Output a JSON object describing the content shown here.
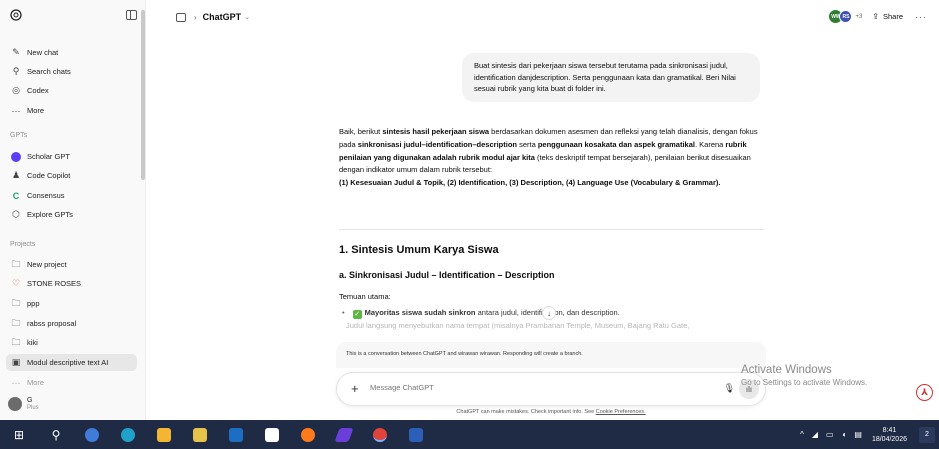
{
  "sidebar": {
    "items": [
      {
        "label": "New chat",
        "icon": "edit-icon"
      },
      {
        "label": "Search chats",
        "icon": "search-icon"
      },
      {
        "label": "Codex",
        "icon": "codex-icon"
      },
      {
        "label": "More",
        "icon": "more-icon"
      }
    ],
    "gpts_label": "GPTs",
    "gpts": [
      {
        "label": "Scholar GPT",
        "color": "#5b3df5"
      },
      {
        "label": "Code Copilot",
        "color": "#2a2a2a"
      },
      {
        "label": "Consensus",
        "color": "#1aa37a"
      },
      {
        "label": "Explore GPTs",
        "color": "#444444"
      }
    ],
    "projects_label": "Projects",
    "projects": [
      {
        "label": "New project",
        "icon": "folder-plus-icon"
      },
      {
        "label": "STONE ROSES",
        "icon": "heart-icon"
      },
      {
        "label": "ppp",
        "icon": "folder-icon"
      },
      {
        "label": "rabss proposal",
        "icon": "folder-icon"
      },
      {
        "label": "kiki",
        "icon": "folder-icon"
      },
      {
        "label": "Modul descriptive text AI",
        "icon": "folder-icon",
        "active": true
      },
      {
        "label": "More",
        "icon": "more-icon"
      }
    ],
    "user": {
      "name": "G",
      "plan": "Plus"
    }
  },
  "header": {
    "title": "ChatGPT",
    "avatars": [
      "WW",
      "RS"
    ],
    "extra_count": "+3",
    "share_label": "Share"
  },
  "chat": {
    "user_message": "Buat sintesis dari pekerjaan siswa tersebut terutama pada sinkronisasi judul, identification danjdescription. Serta penggunaan kata dan gramatikal. Beri Nilai sesuai rubrik yang kita buat di folder ini.",
    "answer": {
      "p1": "Baik, berikut ",
      "p1b": "sintesis hasil pekerjaan siswa",
      "p2": " berdasarkan dokumen asesmen dan refleksi yang telah dianalisis, dengan fokus pada ",
      "p2b": "sinkronisasi judul–identification–description",
      "p3": " serta ",
      "p3b": "penggunaan kosakata dan aspek gramatikal",
      "p4": ". Karena ",
      "p4b": "rubrik penilaian yang digunakan adalah rubrik modul ajar kita",
      "p5": " (teks deskriptif tempat bersejarah), penilaian berikut disesuaikan dengan indikator umum dalam rubrik tersebut:",
      "criteria": "(1) Kesesuaian Judul & Topik, (2) Identification, (3) Description, (4) Language Use (Vocabulary & Grammar)."
    },
    "heading1": "1. Sintesis Umum Karya Siswa",
    "heading2": "a. Sinkronisasi Judul – Identification – Description",
    "finding_label": "Temuan utama:",
    "bullet_bold": "Mayoritas siswa sudah sinkron",
    "bullet_text": " antara judul, identification, dan description.",
    "fade_text": "Judul langsung menyebutkan nama tempat (misalnya Prambanan Temple, Museum, Bajang Ratu Gate,"
  },
  "composer": {
    "notice": "This is a conversation between ChatGPT and wirawan wirawan. Responding will create a branch.",
    "placeholder": "Message ChatGPT",
    "disclaimer": "ChatGPT can make mistakes. Check important info. See ",
    "disclaimer_link": "Cookie Preferences."
  },
  "watermark": {
    "title": "Activate Windows",
    "subtitle": "Go to Settings to activate Windows."
  },
  "taskbar": {
    "time": "8:41",
    "date": "18/04/2026",
    "notification_count": "2"
  },
  "colors": {
    "accent_green": "#5fb646",
    "taskbar": "#1f2a44"
  }
}
